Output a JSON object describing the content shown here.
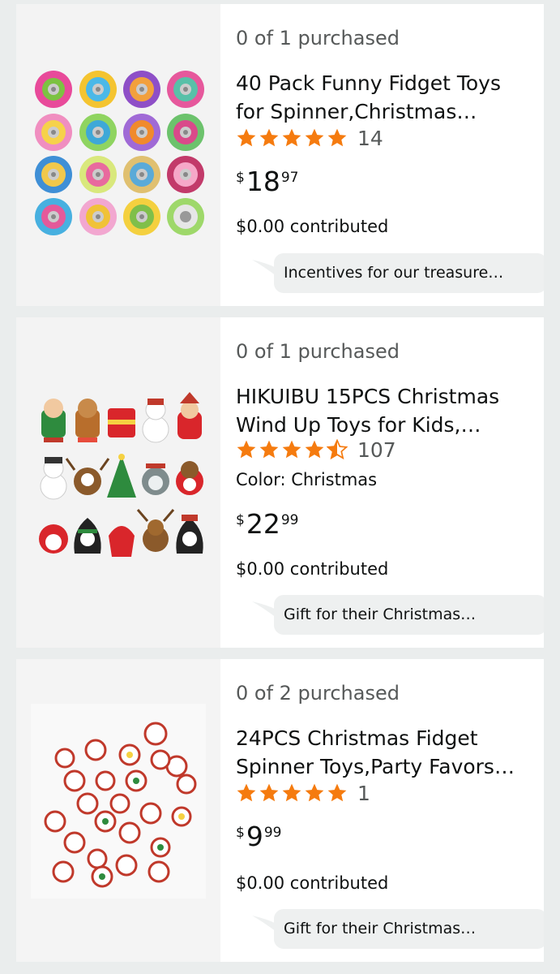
{
  "items": [
    {
      "purchased": "0 of 1 purchased",
      "title": "40 Pack Funny Fidget Toys\nfor Spinner,Christmas…",
      "rating_count": "14",
      "stars": 5,
      "color": null,
      "price": {
        "symbol": "$",
        "whole": "18",
        "fraction": "97"
      },
      "contributed": "$0.00 contributed",
      "note": "Incentives for our treasure…",
      "image_icon": "flower-fidget-spinners-image"
    },
    {
      "purchased": "0 of 1 purchased",
      "title": "HIKUIBU 15PCS Christmas\nWind Up Toys for Kids,…",
      "rating_count": "107",
      "stars": 4.5,
      "color": "Color: Christmas",
      "price": {
        "symbol": "$",
        "whole": "22",
        "fraction": "99"
      },
      "contributed": "$0.00 contributed",
      "note": "Gift for their Christmas…",
      "image_icon": "christmas-wind-up-toys-image"
    },
    {
      "purchased": "0 of 2 purchased",
      "title": "24PCS Christmas Fidget\nSpinner Toys,Party Favors…",
      "rating_count": "1",
      "stars": 5,
      "color": null,
      "price": {
        "symbol": "$",
        "whole": "9",
        "fraction": "99"
      },
      "contributed": "$0.00 contributed",
      "note": "Gift for their Christmas…",
      "image_icon": "christmas-fidget-spinners-image"
    }
  ],
  "colors": {
    "star": "#f57b0f",
    "text": "#0f1111",
    "secondary_text": "#565959",
    "bubble": "#eef0f0",
    "background": "#eaeded"
  }
}
